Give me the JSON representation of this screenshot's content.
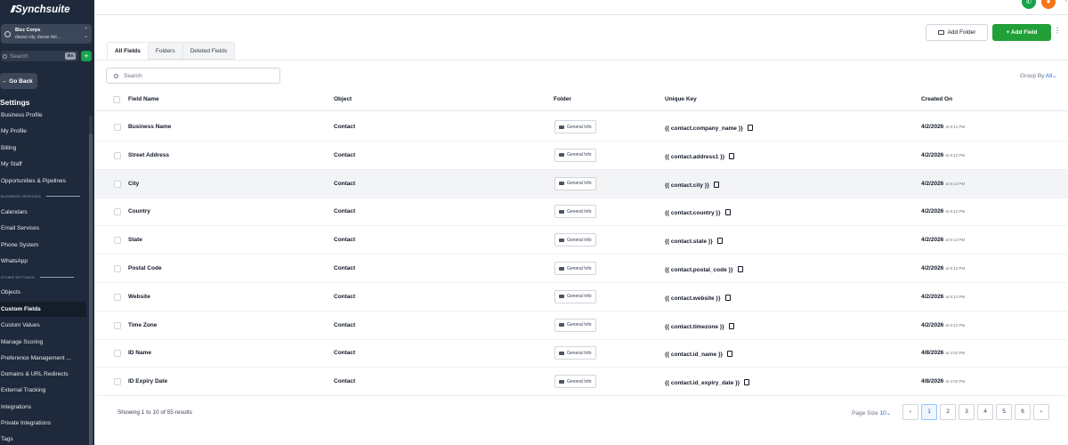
{
  "app": {
    "logo": "Synchsuite"
  },
  "account": {
    "name": "Bizz Corps",
    "location": "davao city, davao del..."
  },
  "sidebar": {
    "search_placeholder": "Search",
    "search_shortcut": "⌘K",
    "add_label": "+",
    "go_back": "← Go Back",
    "settings_title": "Settings",
    "items": [
      {
        "label": "Business Profile"
      },
      {
        "label": "My Profile"
      },
      {
        "label": "Billing"
      },
      {
        "label": "My Staff"
      },
      {
        "label": "Opportunities & Pipelines"
      },
      {
        "label": "BUSINESS SERVICES"
      },
      {
        "label": "Calendars"
      },
      {
        "label": "Email Services"
      },
      {
        "label": "Phone System"
      },
      {
        "label": "WhatsApp"
      },
      {
        "label": "OTHER SETTINGS"
      },
      {
        "label": "Objects"
      },
      {
        "label": "Custom Fields"
      },
      {
        "label": "Custom Values"
      },
      {
        "label": "Manage Scoring"
      },
      {
        "label": "Preference Management ..."
      },
      {
        "label": "Domains & URL Redirects"
      },
      {
        "label": "External Tracking"
      },
      {
        "label": "Integrations"
      },
      {
        "label": "Private Integrations"
      },
      {
        "label": "Tags"
      }
    ]
  },
  "tabs": [
    {
      "label": "All Fields"
    },
    {
      "label": "Folders"
    },
    {
      "label": "Deleted Fields"
    }
  ],
  "actions": {
    "add_folder": "Add Folder",
    "add_field": "+ Add Field"
  },
  "search": {
    "placeholder": "Search"
  },
  "group_by": {
    "label": "Group By",
    "value": "All"
  },
  "table": {
    "columns": [
      "Field Name",
      "Object",
      "Folder",
      "Unique Key",
      "Created On"
    ],
    "rows": [
      {
        "name": "Business Name",
        "object": "Contact",
        "folder": "General Info",
        "key": "{{ contact.company_name }}",
        "date": "4/2/2026",
        "time": "at 9:12 PM"
      },
      {
        "name": "Street Address",
        "object": "Contact",
        "folder": "General Info",
        "key": "{{ contact.address1 }}",
        "date": "4/2/2026",
        "time": "at 9:12 PM"
      },
      {
        "name": "City",
        "object": "Contact",
        "folder": "General Info",
        "key": "{{ contact.city }}",
        "date": "4/2/2026",
        "time": "at 9:12 PM"
      },
      {
        "name": "Country",
        "object": "Contact",
        "folder": "General Info",
        "key": "{{ contact.country }}",
        "date": "4/2/2026",
        "time": "at 9:12 PM"
      },
      {
        "name": "State",
        "object": "Contact",
        "folder": "General Info",
        "key": "{{ contact.state }}",
        "date": "4/2/2026",
        "time": "at 9:12 PM"
      },
      {
        "name": "Postal Code",
        "object": "Contact",
        "folder": "General Info",
        "key": "{{ contact.postal_code }}",
        "date": "4/2/2026",
        "time": "at 9:12 PM"
      },
      {
        "name": "Website",
        "object": "Contact",
        "folder": "General Info",
        "key": "{{ contact.website }}",
        "date": "4/2/2026",
        "time": "at 9:12 PM"
      },
      {
        "name": "Time Zone",
        "object": "Contact",
        "folder": "General Info",
        "key": "{{ contact.timezone }}",
        "date": "4/2/2026",
        "time": "at 9:12 PM"
      },
      {
        "name": "ID Name",
        "object": "Contact",
        "folder": "General Info",
        "key": "{{ contact.id_name }}",
        "date": "4/8/2026",
        "time": "at 4:02 PM"
      },
      {
        "name": "ID Expiry Date",
        "object": "Contact",
        "folder": "General Info",
        "key": "{{ contact.id_expiry_date }}",
        "date": "4/8/2026",
        "time": "at 4:02 PM"
      }
    ]
  },
  "footer": {
    "showing": "Showing 1 to 10 of 55 results",
    "page_size_label": "Page Size",
    "page_size_value": "10",
    "prev": "‹",
    "next": "›",
    "pages": [
      "1",
      "2",
      "3",
      "4",
      "5",
      "6"
    ]
  },
  "colors": {
    "sidebar": "#1e2a3b",
    "primary_green": "#22a038",
    "link_blue": "#2563eb",
    "avatar": "#f97316"
  },
  "icons": {
    "topbar": [
      "phone-icon",
      "user-avatar-icon",
      "more-vertical-icon"
    ],
    "table": [
      "folder-icon",
      "copy-icon"
    ]
  }
}
